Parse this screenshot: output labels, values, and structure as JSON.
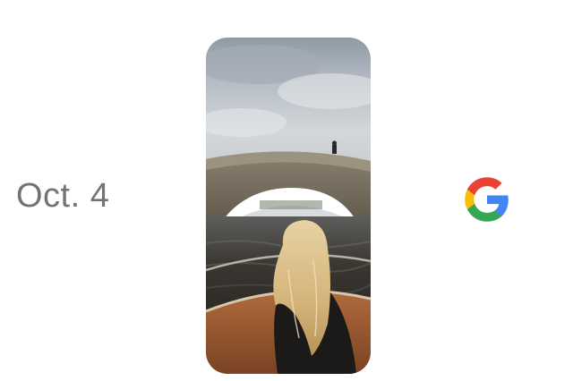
{
  "event": {
    "date_label": "Oct. 4"
  },
  "visual": {
    "photo_subject": "photo",
    "logo": "google-g-logo"
  },
  "colors": {
    "background": "#ffffff",
    "date_text": "#737373",
    "google_blue": "#4285F4",
    "google_red": "#EA4335",
    "google_yellow": "#FBBC05",
    "google_green": "#34A853"
  }
}
